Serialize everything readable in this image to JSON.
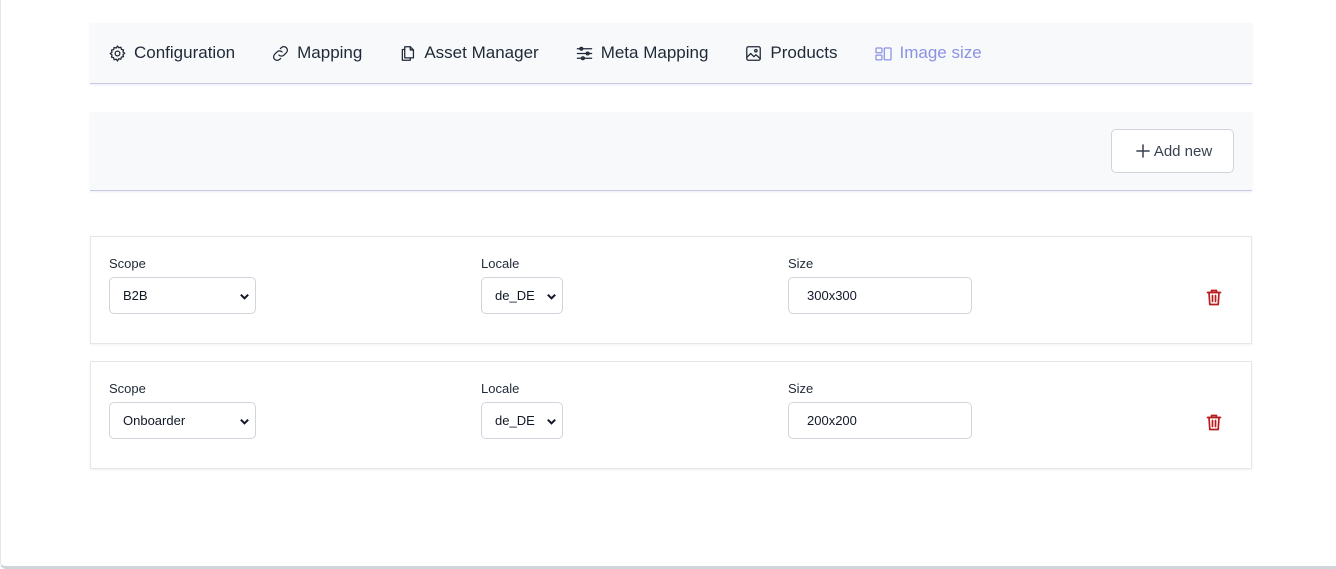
{
  "nav": {
    "tabs": [
      {
        "label": "Configuration",
        "icon": "gear-icon"
      },
      {
        "label": "Mapping",
        "icon": "link-icon"
      },
      {
        "label": "Asset Manager",
        "icon": "documents-icon"
      },
      {
        "label": "Meta Mapping",
        "icon": "sliders-icon"
      },
      {
        "label": "Products",
        "icon": "image-icon"
      },
      {
        "label": "Image size",
        "icon": "layout-icon",
        "active": true
      }
    ]
  },
  "toolbar": {
    "add_label": "Add new"
  },
  "rows": [
    {
      "scope_label": "Scope",
      "scope_value": "B2B",
      "locale_label": "Locale",
      "locale_value": "de_DE",
      "size_label": "Size",
      "size_value": "300x300"
    },
    {
      "scope_label": "Scope",
      "scope_value": "Onboarder",
      "locale_label": "Locale",
      "locale_value": "de_DE",
      "size_label": "Size",
      "size_value": "200x200"
    }
  ],
  "colors": {
    "active_tab": "#8b92e6",
    "delete": "#b91c1c",
    "panel_bg": "#f8f9fb"
  }
}
